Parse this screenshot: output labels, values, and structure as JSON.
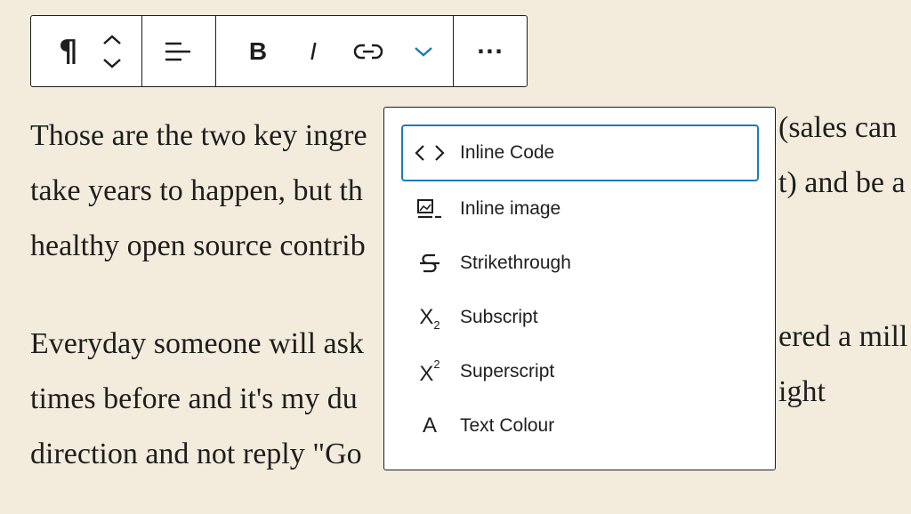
{
  "toolbar": {
    "paragraph_glyph": "¶",
    "bold_label": "B",
    "italic_label": "I",
    "more_label": "···",
    "accent_color": "#1f7bb6"
  },
  "content": {
    "paragraphs": [
      [
        "Those are the two key ingre",
        "take years to happen, but th",
        "healthy open source contrib"
      ],
      [
        "Everyday someone will ask ",
        "times before and it's my du",
        "direction and not reply \"Go"
      ]
    ],
    "right_fragments": [
      "(sales can",
      "t) and be a",
      "ered a mill",
      "ight"
    ]
  },
  "dropdown": {
    "items": [
      {
        "label": "Inline Code",
        "icon": "code-icon",
        "focused": true
      },
      {
        "label": "Inline image",
        "icon": "inline-image-icon"
      },
      {
        "label": "Strikethrough",
        "icon": "strikethrough-icon"
      },
      {
        "label": "Subscript",
        "icon": "subscript-icon",
        "glyph": "X",
        "script": "2"
      },
      {
        "label": "Superscript",
        "icon": "superscript-icon",
        "glyph": "X",
        "script": "2"
      },
      {
        "label": "Text Colour",
        "icon": "text-colour-icon",
        "glyph": "A"
      }
    ]
  }
}
